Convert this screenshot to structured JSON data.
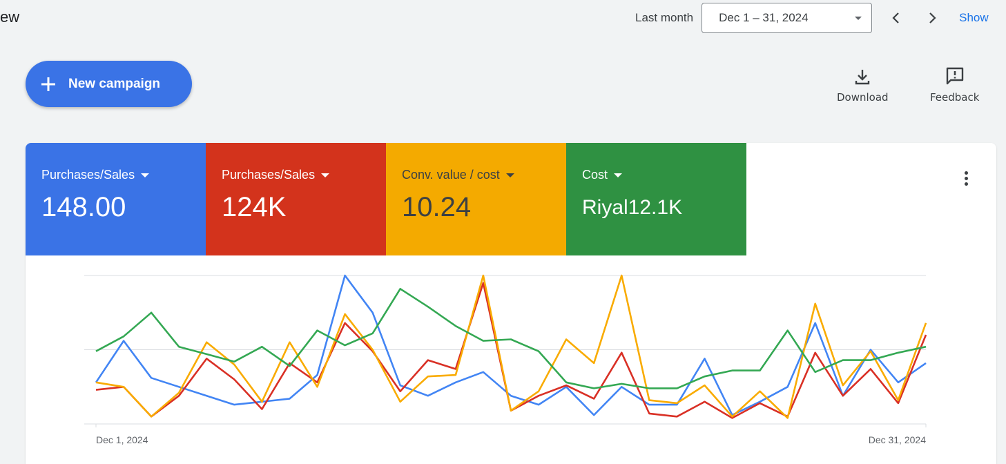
{
  "header": {
    "title_fragment": "ew",
    "range_label": "Last month",
    "date_range": "Dec 1 – 31, 2024",
    "show_link": "Show"
  },
  "toolbar": {
    "new_campaign_label": "New campaign",
    "download_label": "Download",
    "feedback_label": "Feedback"
  },
  "metrics": [
    {
      "label": "Purchases/Sales",
      "value": "148.00",
      "bg": "#3a73e6",
      "fg": "#ffffff"
    },
    {
      "label": "Purchases/Sales",
      "value": "124K",
      "bg": "#d3331c",
      "fg": "#ffffff"
    },
    {
      "label": "Conv. value / cost",
      "value": "10.24",
      "bg": "#f4aa00",
      "fg": "#3c4043"
    },
    {
      "label": "Cost",
      "value": "Riyal12.1K",
      "bg": "#2f9142",
      "fg": "#ffffff"
    }
  ],
  "icons": {
    "new_campaign": "plus-icon",
    "download": "download-icon",
    "feedback": "feedback-icon",
    "more": "more-vert-icon",
    "date_dropdown": "caret-down-icon",
    "prev": "chevron-left-icon",
    "next": "chevron-right-icon"
  },
  "chart_data": {
    "type": "line",
    "x_start_label": "Dec 1, 2024",
    "x_end_label": "Dec 31, 2024",
    "ylim": [
      0,
      100
    ],
    "gridlines": [
      0,
      50,
      100
    ],
    "grid": true,
    "series": [
      {
        "color": "#4285f4",
        "values": [
          28,
          56,
          31,
          25,
          19,
          13,
          15,
          17,
          33,
          100,
          75,
          26,
          19,
          28,
          35,
          19,
          13,
          25,
          6,
          25,
          13,
          13,
          44,
          6,
          15,
          25,
          68,
          19,
          50,
          28,
          41
        ]
      },
      {
        "color": "#d93025",
        "values": [
          23,
          25,
          5,
          19,
          44,
          30,
          10,
          41,
          28,
          68,
          49,
          22,
          43,
          37,
          95,
          9,
          19,
          26,
          17,
          48,
          7,
          5,
          15,
          4,
          14,
          5,
          48,
          19,
          37,
          14,
          60
        ]
      },
      {
        "color": "#f9ab00",
        "values": [
          28,
          25,
          5,
          21,
          55,
          40,
          15,
          55,
          25,
          74,
          50,
          15,
          32,
          33,
          100,
          9,
          22,
          57,
          41,
          100,
          16,
          14,
          26,
          5,
          22,
          4,
          81,
          26,
          49,
          16,
          68
        ]
      },
      {
        "color": "#34a853",
        "values": [
          49,
          59,
          75,
          52,
          47,
          42,
          52,
          39,
          63,
          53,
          61,
          91,
          79,
          66,
          56,
          57,
          49,
          28,
          24,
          27,
          24,
          24,
          32,
          36,
          36,
          63,
          35,
          43,
          43,
          48,
          52
        ]
      }
    ]
  }
}
